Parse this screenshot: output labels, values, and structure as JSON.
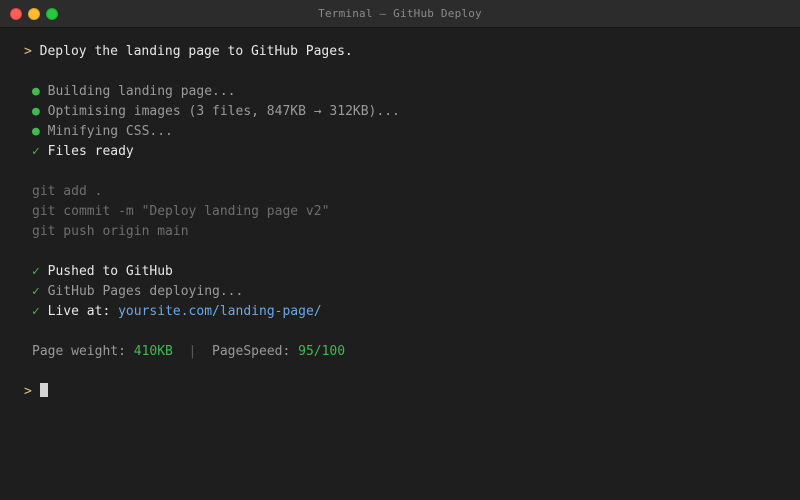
{
  "window": {
    "title": "Terminal — GitHub Deploy"
  },
  "colors": {
    "background": "#1e1e1e",
    "prompt": "#e5c07b",
    "success": "#3fb950",
    "link": "#6ba8e8",
    "muted": "#9a9a9a"
  },
  "prompt_symbol": ">",
  "command": "Deploy the landing page to GitHub Pages.",
  "build_steps": [
    {
      "icon": "●",
      "text": "Building landing page..."
    },
    {
      "icon": "●",
      "text": "Optimising images (3 files, 847KB → 312KB)..."
    },
    {
      "icon": "●",
      "text": "Minifying CSS..."
    },
    {
      "icon": "✓",
      "text": "Files ready"
    }
  ],
  "git_commands": [
    "git add .",
    "git commit -m \"Deploy landing page v2\"",
    "git push origin main"
  ],
  "results": {
    "pushed": {
      "icon": "✓",
      "text": "Pushed to GitHub"
    },
    "deploying": {
      "icon": "✓",
      "text": "GitHub Pages deploying..."
    },
    "live": {
      "icon": "✓",
      "label": "Live at: ",
      "url": "yoursite.com/landing-page/"
    }
  },
  "stats": {
    "weight_label": "Page weight: ",
    "weight_value": "410KB",
    "separator": "  |  ",
    "speed_label": "PageSpeed: ",
    "speed_value": "95/100"
  }
}
